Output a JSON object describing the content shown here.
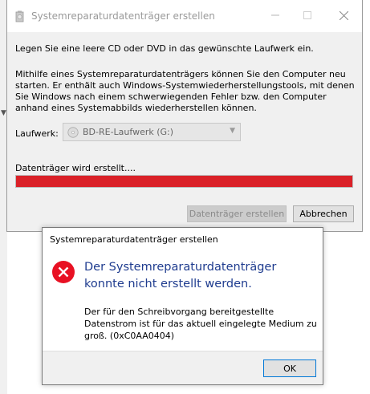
{
  "main_dialog": {
    "title": "Systemreparaturdatenträger erstellen",
    "instruction": "Legen Sie eine leere CD oder DVD in das gewünschte Laufwerk ein.",
    "description": "Mithilfe eines Systemreparaturdatenträgers können Sie den Computer neu starten. Er enthält auch Windows-Systemwiederherstellungstools, mit denen Sie Windows nach einem schwerwiegenden Fehler bzw. den Computer anhand eines Systemabbilds wiederherstellen können.",
    "drive_label": "Laufwerk:",
    "drive_selected": "BD-RE-Laufwerk (G:)",
    "progress_label": "Datenträger wird erstellt....",
    "progress_value": 1.0,
    "progress_color": "#da2128",
    "create_button": "Datenträger erstellen",
    "cancel_button": "Abbrechen",
    "window_controls": [
      "minimize-icon",
      "maximize-icon",
      "close-icon"
    ]
  },
  "error_dialog": {
    "title": "Systemreparaturdatenträger erstellen",
    "heading": "Der Systemreparaturdatenträger konnte nicht erstellt werden.",
    "detail": "Der für den Schreibvorgang bereitgestellte Datenstrom ist für das aktuell eingelegte Medium zu groß. (0xC0AA0404)",
    "ok_button": "OK",
    "icon": "error-icon",
    "heading_color": "#1f3c8f"
  }
}
